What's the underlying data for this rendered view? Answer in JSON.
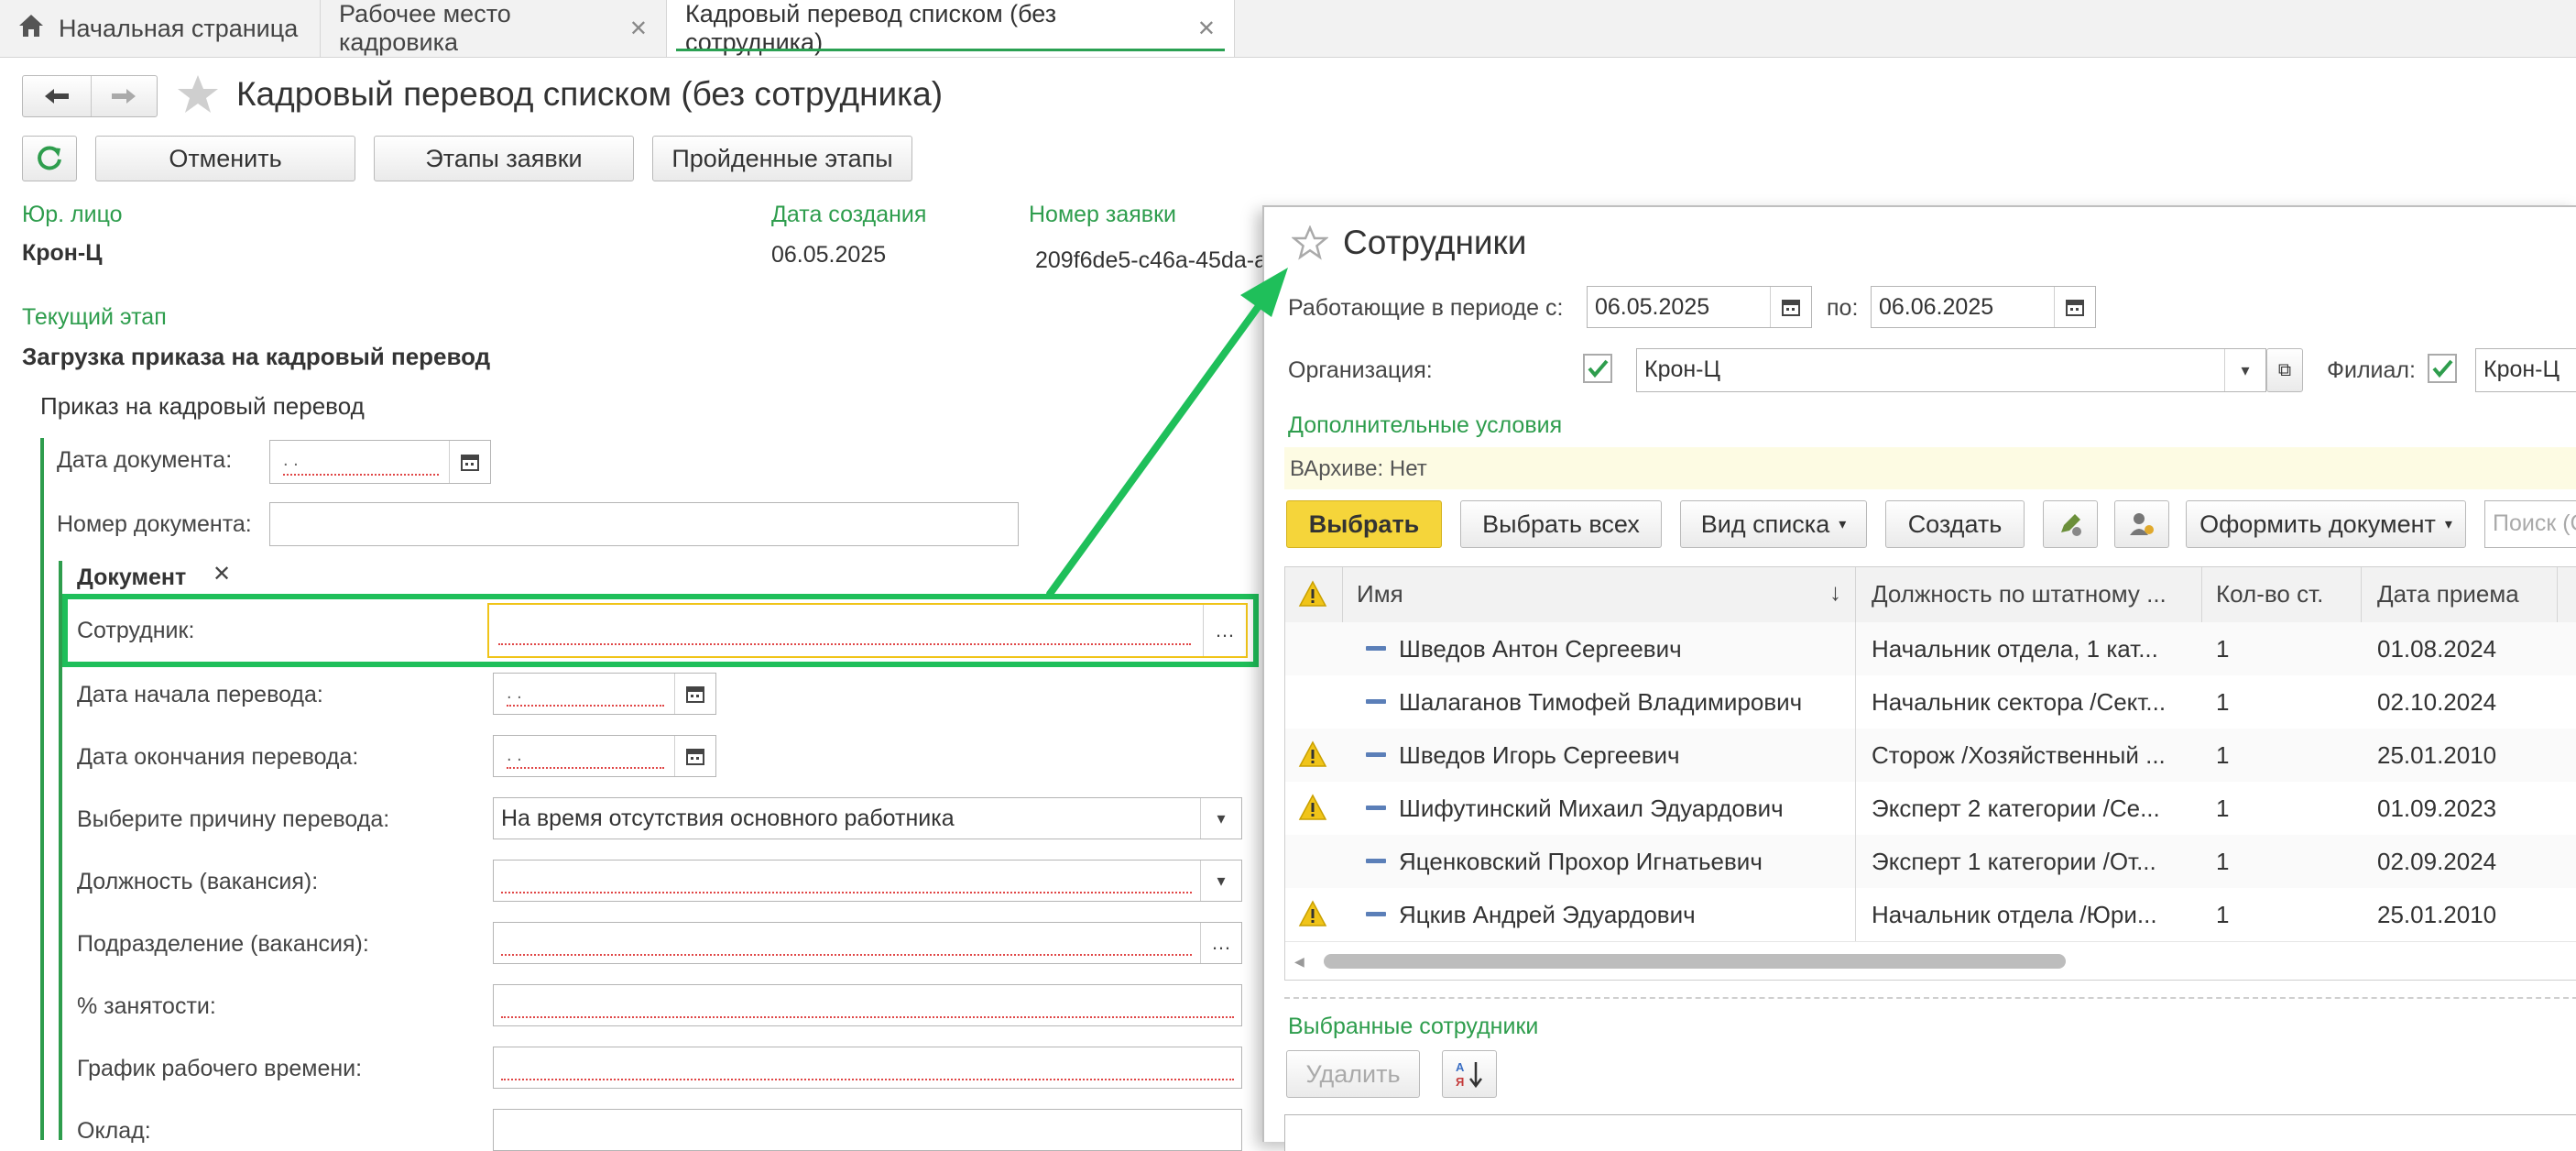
{
  "tabs": {
    "home": "Начальная страница",
    "workplace": "Рабочее место кадровика",
    "current": "Кадровый перевод списком (без сотрудника)"
  },
  "form": {
    "title": "Кадровый перевод списком (без сотрудника)",
    "buttons": {
      "cancel": "Отменить",
      "stages": "Этапы заявки",
      "passed": "Пройденные этапы"
    },
    "legal_entity_label": "Юр. лицо",
    "legal_entity_value": "Крон-Ц",
    "created_label": "Дата создания",
    "created_value": "06.05.2025",
    "request_no_label": "Номер заявки",
    "request_no_value": "209f6de5-c46a-45da-a",
    "stage_label": "Текущий этап",
    "stage_value": "Загрузка приказа на кадровый перевод",
    "group_title": "Приказ на кадровый перевод",
    "doc_date_label": "Дата документа:",
    "doc_date_value": ". .",
    "doc_number_label": "Номер документа:",
    "doc_section_label": "Документ",
    "employee_label": "Сотрудник:",
    "start_label": "Дата начала перевода:",
    "start_value": ". .",
    "end_label": "Дата окончания перевода:",
    "end_value": ". .",
    "reason_label": "Выберите причину перевода:",
    "reason_value": "На время отсутствия основного работника",
    "position_label": "Должность (вакансия):",
    "dept_label": "Подразделение (вакансия):",
    "employment_label": "% занятости:",
    "schedule_label": "График рабочего времени:",
    "salary_label": "Оклад:"
  },
  "modal": {
    "title": "Сотрудники",
    "period_label": "Работающие в периоде с:",
    "period_from": "06.05.2025",
    "period_to_label": "по:",
    "period_to": "06.06.2025",
    "org_label": "Организация:",
    "org_value": "Крон-Ц",
    "branch_label": "Филиал:",
    "branch_value": "Крон-Ц",
    "extra_conditions": "Дополнительные условия",
    "archive_filter": "ВАрхиве: Нет",
    "buttons": {
      "select": "Выбрать",
      "select_all": "Выбрать всех",
      "list_view": "Вид списка",
      "create": "Создать",
      "make_doc": "Оформить документ",
      "search_placeholder": "Поиск (C"
    },
    "columns": {
      "name": "Имя",
      "position": "Должность по штатному ...",
      "count": "Кол-во ст.",
      "hire_date": "Дата приема"
    },
    "rows": [
      {
        "warn": false,
        "name": "Шведов  Антон Сергеевич",
        "position": "Начальник отдела, 1 кат...",
        "count": "1",
        "hire_date": "01.08.2024"
      },
      {
        "warn": false,
        "name": "Шалаганов Тимофей Владимирович",
        "position": "Начальник сектора /Сект...",
        "count": "1",
        "hire_date": "02.10.2024"
      },
      {
        "warn": true,
        "name": "Шведов Игорь Сергеевич",
        "position": "Сторож /Хозяйственный ...",
        "count": "1",
        "hire_date": "25.01.2010"
      },
      {
        "warn": true,
        "name": "Шифутинский Михаил Эдуардович",
        "position": "Эксперт 2 категории /Се...",
        "count": "1",
        "hire_date": "01.09.2023"
      },
      {
        "warn": false,
        "name": "Яценковский Прохор Игнатьевич",
        "position": "Эксперт 1 категории /От...",
        "count": "1",
        "hire_date": "02.09.2024"
      },
      {
        "warn": true,
        "name": "Яцкив Андрей Эдуардович",
        "position": "Начальник отдела /Юри...",
        "count": "1",
        "hire_date": "25.01.2010"
      }
    ],
    "selected_title": "Выбранные сотрудники",
    "delete_button": "Удалить",
    "sort_glyph": "А↓Я"
  },
  "colors": {
    "accent": "#2e9d4d",
    "highlight": "#1fbf5a",
    "primary_button": "#f5d53a"
  }
}
